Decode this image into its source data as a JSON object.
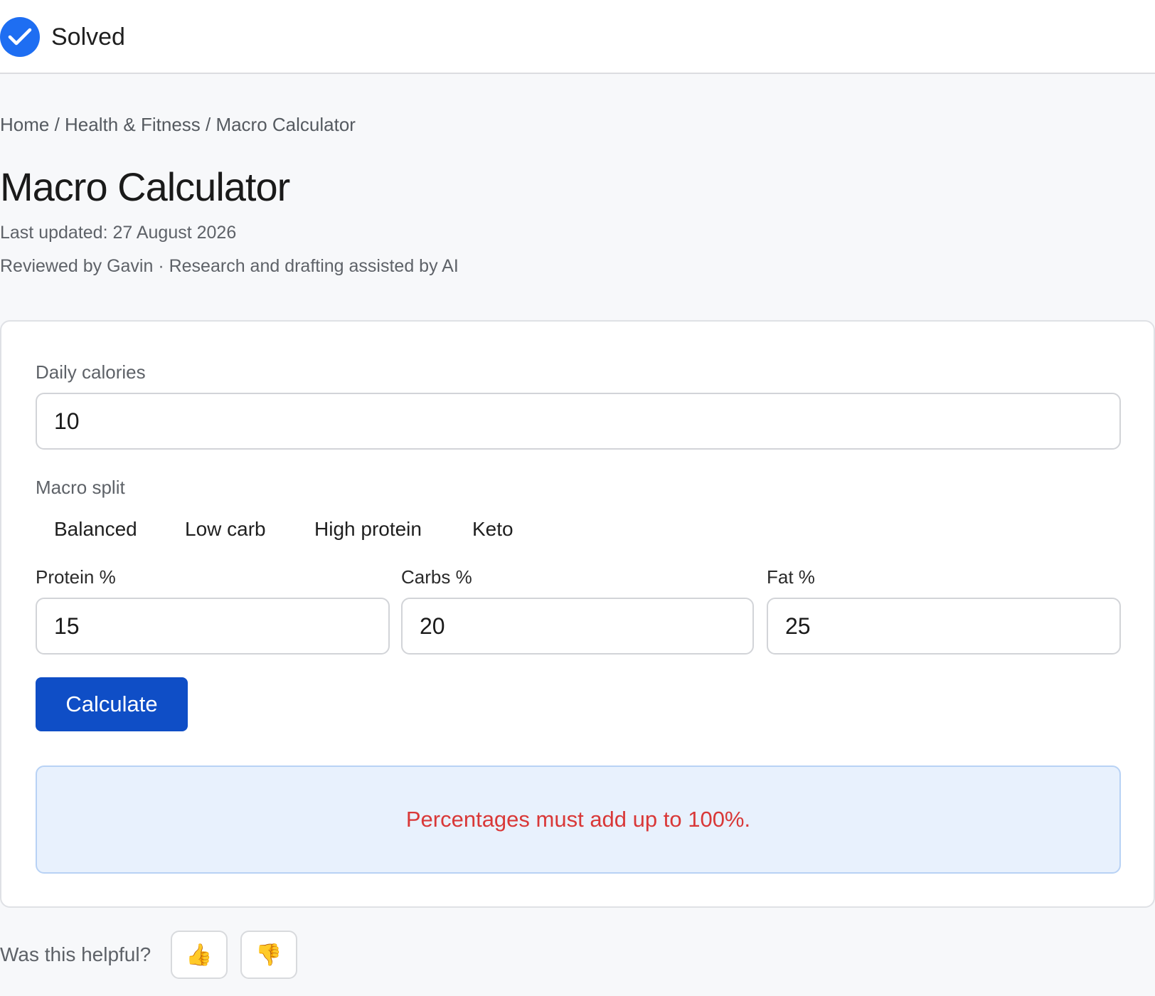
{
  "header": {
    "status_label": "Solved",
    "status_icon": "check-circle-icon",
    "accent_color": "#1e6ef2"
  },
  "breadcrumb": {
    "text": "Home / Health & Fitness / Macro Calculator"
  },
  "page": {
    "title": "Macro Calculator",
    "last_updated": "Last updated: 27 August 2026",
    "reviewed_by": "Reviewed by Gavin · Research and drafting assisted by AI"
  },
  "calculator": {
    "calories_label": "Daily calories",
    "calories_value": "10",
    "split_label": "Macro split",
    "presets": [
      "Balanced",
      "Low carb",
      "High protein",
      "Keto"
    ],
    "protein_label": "Protein %",
    "protein_value": "15",
    "carbs_label": "Carbs %",
    "carbs_value": "20",
    "fat_label": "Fat %",
    "fat_value": "25",
    "calculate_label": "Calculate",
    "button_color": "#0f4ec6"
  },
  "result": {
    "error_message": "Percentages must add up to 100%.",
    "error_color": "#d93838",
    "background_color": "#e8f1fd"
  },
  "feedback": {
    "question": "Was this helpful?",
    "thumbs_up": "👍",
    "thumbs_down": "👎"
  }
}
